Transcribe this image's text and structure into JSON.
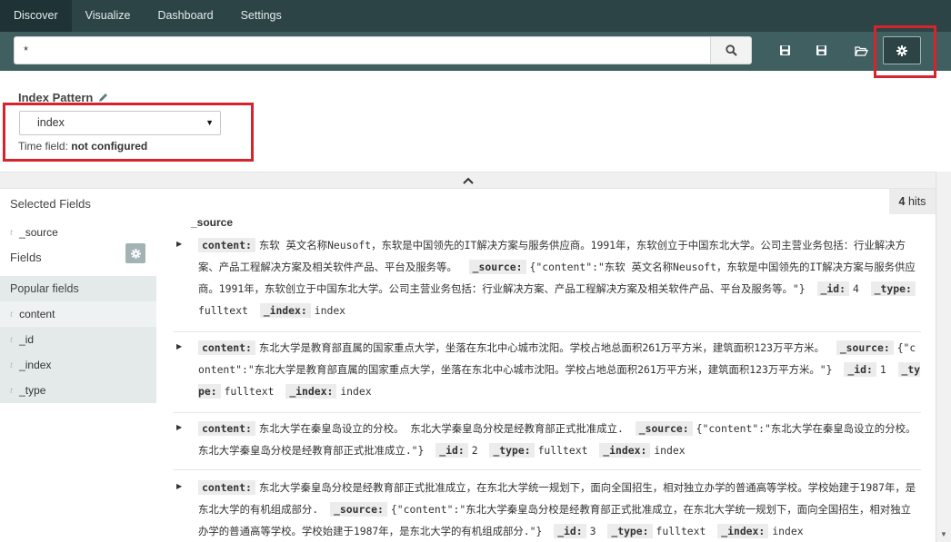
{
  "nav": {
    "tabs": [
      "Discover",
      "Visualize",
      "Dashboard",
      "Settings"
    ]
  },
  "search": {
    "query": "*"
  },
  "index_pattern": {
    "title": "Index Pattern",
    "selected": "index",
    "time_field_label": "Time field:",
    "time_field_value": "not configured"
  },
  "sidebar": {
    "selected_fields_title": "Selected Fields",
    "selected_fields": [
      "_source"
    ],
    "fields_title": "Fields",
    "popular_title": "Popular fields",
    "popular_fields": [
      "content",
      "_id",
      "_index",
      "_type"
    ]
  },
  "results": {
    "hits_count": "4",
    "hits_label": "hits",
    "column": "_source",
    "docs": [
      {
        "content": "东软 英文名称Neusoft，东软是中国领先的IT解决方案与服务供应商。1991年，东软创立于中国东北大学。公司主营业务包括：行业解决方案、产品工程解决方案及相关软件产品、平台及服务等。",
        "source": "{\"content\":\"东软 英文名称Neusoft，东软是中国领先的IT解决方案与服务供应商。1991年，东软创立于中国东北大学。公司主营业务包括：行业解决方案、产品工程解决方案及相关软件产品、平台及服务等。\"}",
        "id": "4",
        "type": "fulltext",
        "index": "index"
      },
      {
        "content": "东北大学是教育部直属的国家重点大学，坐落在东北中心城市沈阳。学校占地总面积261万平方米，建筑面积123万平方米。",
        "source": "{\"content\":\"东北大学是教育部直属的国家重点大学，坐落在东北中心城市沈阳。学校占地总面积261万平方米，建筑面积123万平方米。\"}",
        "id": "1",
        "type": "fulltext",
        "index": "index"
      },
      {
        "content": "东北大学在秦皇岛设立的分校。 东北大学秦皇岛分校是经教育部正式批准成立.",
        "source": "{\"content\":\"东北大学在秦皇岛设立的分校。 东北大学秦皇岛分校是经教育部正式批准成立.\"}",
        "id": "2",
        "type": "fulltext",
        "index": "index"
      },
      {
        "content": "东北大学秦皇岛分校是经教育部正式批准成立，在东北大学统一规划下，面向全国招生，相对独立办学的普通高等学校。学校始建于1987年，是东北大学的有机组成部分.",
        "source": "{\"content\":\"东北大学秦皇岛分校是经教育部正式批准成立，在东北大学统一规划下，面向全国招生，相对独立办学的普通高等学校。学校始建于1987年，是东北大学的有机组成部分.\"}",
        "id": "3",
        "type": "fulltext",
        "index": "index"
      }
    ],
    "keys": {
      "content": "content:",
      "source": "_source:",
      "id": "_id:",
      "type": "_type:",
      "index": "_index:"
    }
  },
  "colors": {
    "nav_bg": "#2d4447",
    "toolbar_bg": "#3f5f61",
    "highlight_red": "#d6232c"
  }
}
